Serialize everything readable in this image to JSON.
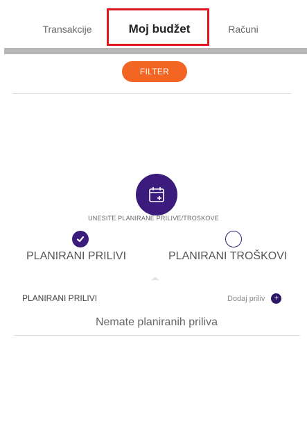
{
  "tabs": [
    {
      "label": "Transakcije"
    },
    {
      "label": "Moj budžet"
    },
    {
      "label": "Računi"
    }
  ],
  "filter": {
    "label": "FILTER"
  },
  "hint": "UNESITE PLANIRANE PRILIVE/TROSKOVE",
  "options": {
    "income": {
      "label": "PLANIRANI PRILIVI",
      "selected": true
    },
    "expenses": {
      "label": "PLANIRANI TROŠKOVI",
      "selected": false
    }
  },
  "section": {
    "title": "PLANIRANI PRILIVI",
    "add_label": "Dodaj priliv",
    "add_symbol": "+",
    "empty_text": "Nemate planiranih priliva"
  },
  "colors": {
    "accent": "#f26522",
    "brand": "#3b1c7c",
    "highlight": "#e0161f"
  }
}
